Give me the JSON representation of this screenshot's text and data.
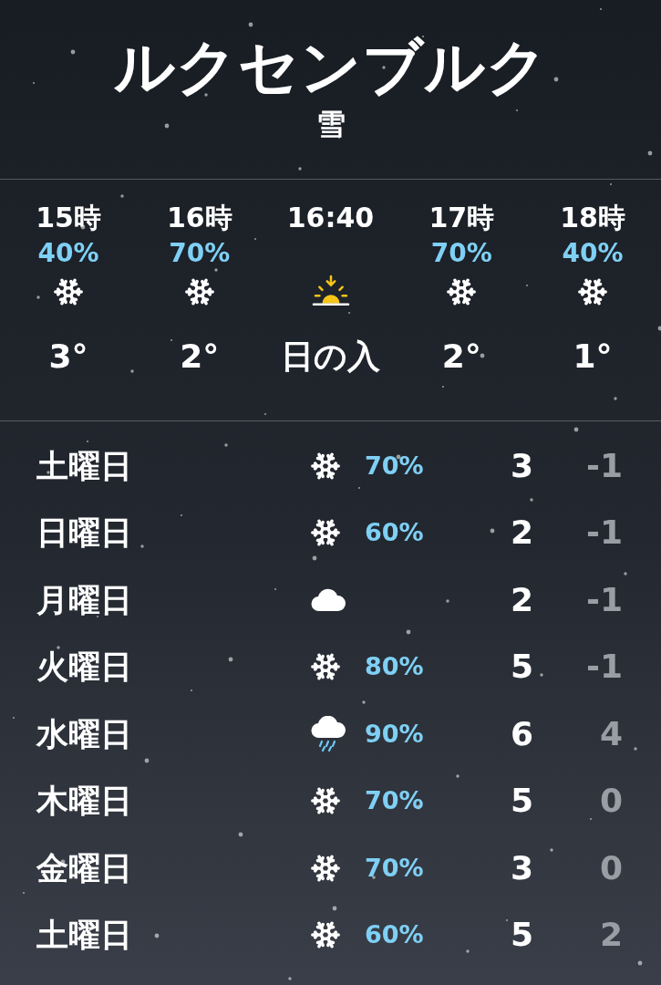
{
  "city": "ルクセンブルク",
  "condition": "雪",
  "hourly": [
    {
      "kind": "snow",
      "time": "15時",
      "chance": "40%",
      "temp": "3°"
    },
    {
      "kind": "snow",
      "time": "16時",
      "chance": "70%",
      "temp": "2°"
    },
    {
      "kind": "sunset",
      "time": "16:40",
      "temp": "日の入"
    },
    {
      "kind": "snow",
      "time": "17時",
      "chance": "70%",
      "temp": "2°"
    },
    {
      "kind": "snow",
      "time": "18時",
      "chance": "40%",
      "temp": "1°"
    }
  ],
  "daily": [
    {
      "day": "土曜日",
      "kind": "snow",
      "chance": "70%",
      "high": "3",
      "low": "-1"
    },
    {
      "day": "日曜日",
      "kind": "snow",
      "chance": "60%",
      "high": "2",
      "low": "-1"
    },
    {
      "day": "月曜日",
      "kind": "cloud",
      "high": "2",
      "low": "-1"
    },
    {
      "day": "火曜日",
      "kind": "snow",
      "chance": "80%",
      "high": "5",
      "low": "-1"
    },
    {
      "day": "水曜日",
      "kind": "rain",
      "chance": "90%",
      "high": "6",
      "low": "4"
    },
    {
      "day": "木曜日",
      "kind": "snow",
      "chance": "70%",
      "high": "5",
      "low": "0"
    },
    {
      "day": "金曜日",
      "kind": "snow",
      "chance": "70%",
      "high": "3",
      "low": "0"
    },
    {
      "day": "土曜日",
      "kind": "snow",
      "chance": "60%",
      "high": "5",
      "low": "2"
    }
  ]
}
